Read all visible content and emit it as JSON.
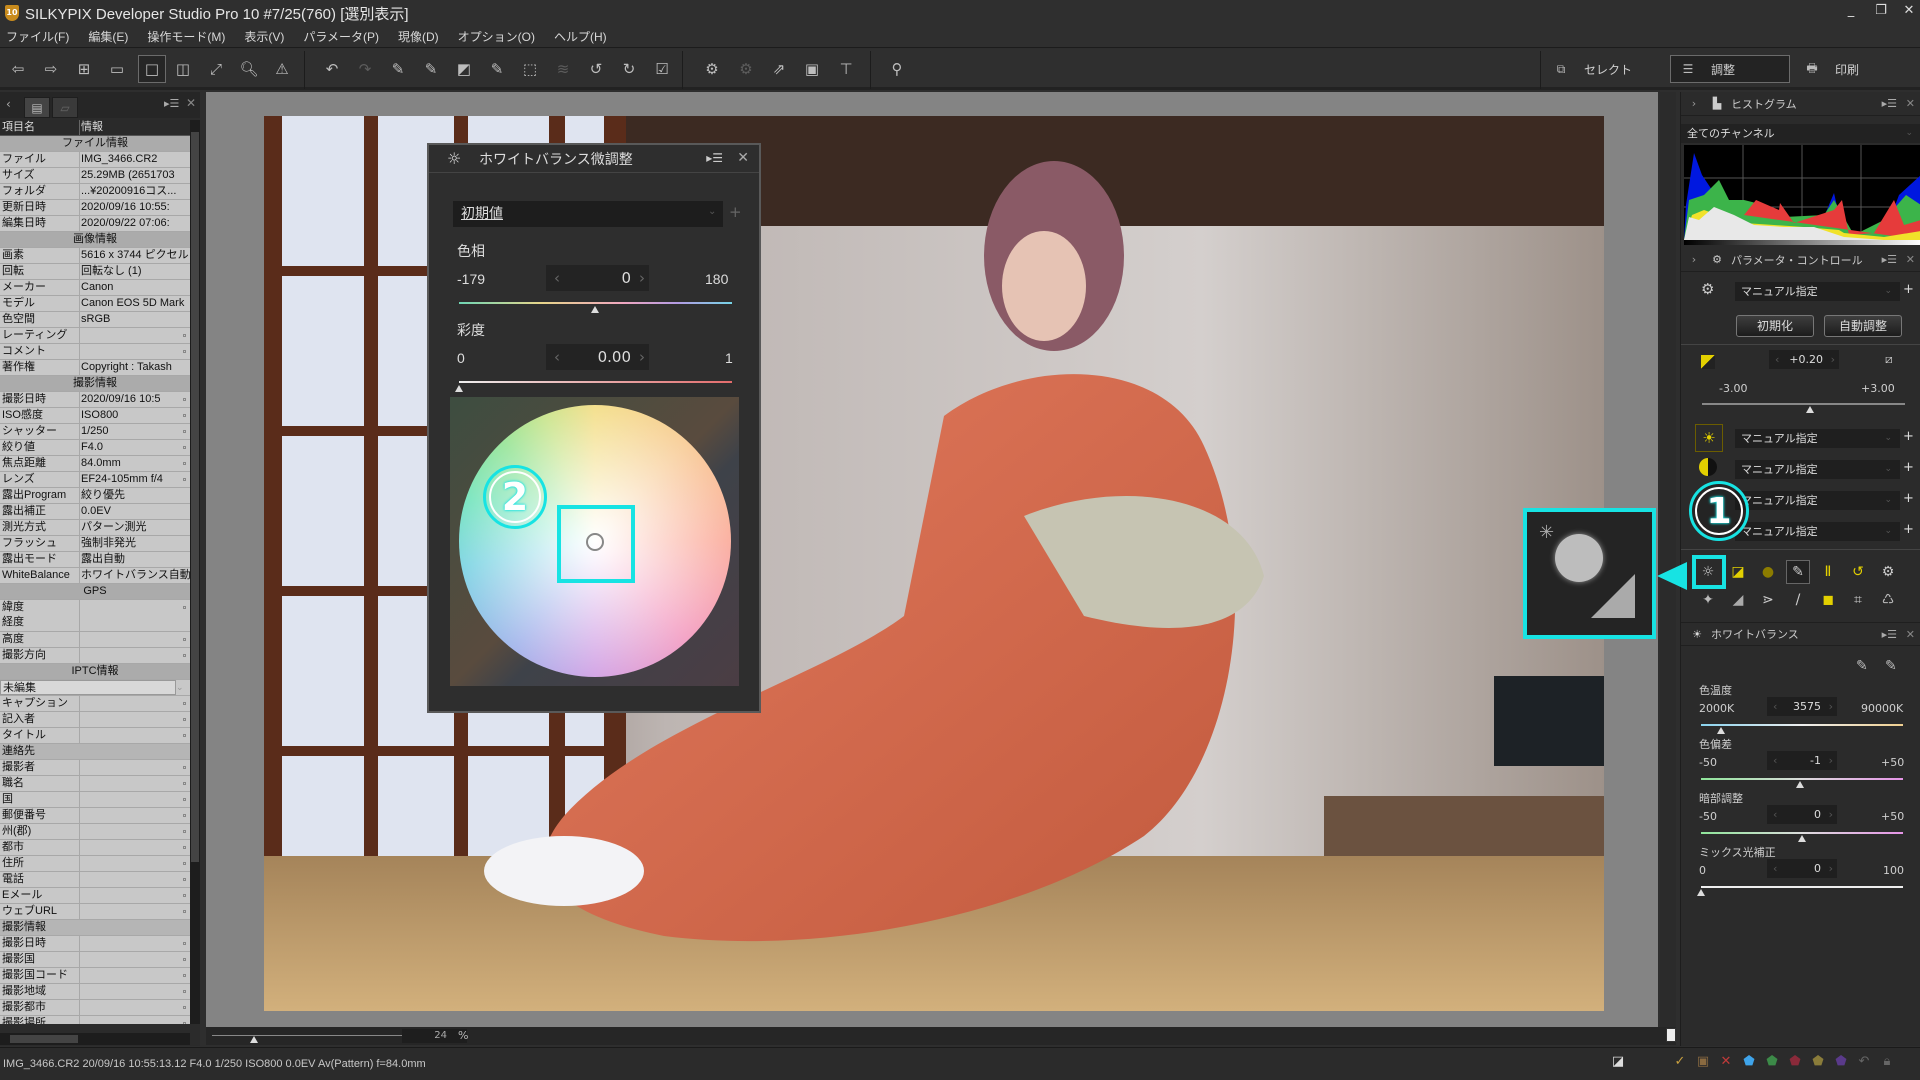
{
  "window": {
    "title": "SILKYPIX Developer Studio Pro 10   #7/25(760) [選別表示]",
    "app_icon_text": "10",
    "controls": {
      "minimize": "_",
      "restore": "❐",
      "close": "✕"
    }
  },
  "menu": [
    "ファイル(F)",
    "編集(E)",
    "操作モード(M)",
    "表示(V)",
    "パラメータ(P)",
    "現像(D)",
    "オプション(O)",
    "ヘルプ(H)"
  ],
  "toolbar": {
    "icons": [
      "prev-photo-icon",
      "next-photo-icon",
      "thumbnail-view-icon",
      "preview-thumbnail-view-icon",
      "single-view-icon",
      "compare-view-icon",
      "fullscreen-icon",
      "loupe-icon",
      "warning-icon",
      "undo-icon",
      "redo-icon",
      "exposure-tool-icon",
      "gray-tool-icon",
      "contrast-tool-icon",
      "film-tool-icon",
      "transform-icon",
      "layers-icon",
      "rotate-left-icon",
      "rotate-right-icon",
      "check-icon",
      "save-params-icon",
      "apply-params-icon",
      "export-icon",
      "display-icon",
      "hammer-icon",
      "search-zoom-icon"
    ],
    "modes": [
      {
        "label": "セレクト",
        "icon": "select-mode-icon",
        "active": false
      },
      {
        "label": "調整",
        "icon": "adjust-mode-icon",
        "active": true
      },
      {
        "label": "印刷",
        "icon": "printer-icon",
        "active": false
      }
    ]
  },
  "left_panel": {
    "header": {
      "key": "項目名",
      "value": "情報"
    },
    "rows": [
      {
        "type": "section",
        "label": "ファイル情報"
      },
      {
        "k": "ファイル",
        "v": "IMG_3466.CR2"
      },
      {
        "k": "サイズ",
        "v": "25.29MB (2651703"
      },
      {
        "k": "フォルダ",
        "v": "...¥20200916コス..."
      },
      {
        "k": "更新日時",
        "v": "2020/09/16 10:55:"
      },
      {
        "k": "編集日時",
        "v": "2020/09/22 07:06:"
      },
      {
        "type": "section",
        "label": "画像情報"
      },
      {
        "k": "画素",
        "v": "5616 x 3744 ピクセル"
      },
      {
        "k": "回転",
        "v": "回転なし (1)"
      },
      {
        "k": "メーカー",
        "v": "Canon"
      },
      {
        "k": "モデル",
        "v": "Canon EOS 5D Mark"
      },
      {
        "k": "色空間",
        "v": "sRGB"
      },
      {
        "k": "レーティング",
        "v": "",
        "dot": true
      },
      {
        "k": "コメント",
        "v": "",
        "dot": true
      },
      {
        "k": "著作権",
        "v": "Copyright : Takash"
      },
      {
        "type": "section",
        "label": "撮影情報"
      },
      {
        "k": "撮影日時",
        "v": "2020/09/16 10:5",
        "dot": true
      },
      {
        "k": "ISO感度",
        "v": "ISO800",
        "dot": true
      },
      {
        "k": "シャッター",
        "v": "1/250",
        "dot": true
      },
      {
        "k": "絞り値",
        "v": "F4.0",
        "dot": true
      },
      {
        "k": "焦点距離",
        "v": "84.0mm",
        "dot": true
      },
      {
        "k": "レンズ",
        "v": "EF24-105mm f/4",
        "dot": true
      },
      {
        "k": "露出Program",
        "v": "絞り優先"
      },
      {
        "k": "露出補正",
        "v": "0.0EV"
      },
      {
        "k": "測光方式",
        "v": "パターン測光"
      },
      {
        "k": "フラッシュ",
        "v": "強制非発光"
      },
      {
        "k": "露出モード",
        "v": "露出自動"
      },
      {
        "k": "WhiteBalance",
        "v": "ホワイトバランス自動"
      },
      {
        "type": "section",
        "label": "GPS"
      },
      {
        "k": "緯度\n経度",
        "v": "",
        "dot": true,
        "tall": true
      },
      {
        "k": "高度",
        "v": "",
        "dot": true
      },
      {
        "k": "撮影方向",
        "v": "",
        "dot": true
      },
      {
        "type": "section",
        "label": "IPTC情報"
      },
      {
        "type": "select",
        "label": "未編集"
      },
      {
        "k": "キャプション",
        "v": "",
        "dot": true
      },
      {
        "k": "記入者",
        "v": "",
        "dot": true
      },
      {
        "k": "タイトル",
        "v": "",
        "dot": true
      },
      {
        "type": "subsection",
        "label": "連絡先"
      },
      {
        "k": "撮影者",
        "v": "",
        "dot": true
      },
      {
        "k": "職名",
        "v": "",
        "dot": true
      },
      {
        "k": "国",
        "v": "",
        "dot": true
      },
      {
        "k": "郵便番号",
        "v": "",
        "dot": true
      },
      {
        "k": "州(郡)",
        "v": "",
        "dot": true
      },
      {
        "k": "都市",
        "v": "",
        "dot": true
      },
      {
        "k": "住所",
        "v": "",
        "dot": true
      },
      {
        "k": "電話",
        "v": "",
        "dot": true
      },
      {
        "k": "Eメール",
        "v": "",
        "dot": true
      },
      {
        "k": "ウェブURL",
        "v": "",
        "dot": true
      },
      {
        "type": "subsection",
        "label": "撮影情報"
      },
      {
        "k": "撮影日時",
        "v": "",
        "dot": true
      },
      {
        "k": "撮影国",
        "v": "",
        "dot": true
      },
      {
        "k": "撮影国コード",
        "v": "",
        "dot": true
      },
      {
        "k": "撮影地域",
        "v": "",
        "dot": true
      },
      {
        "k": "撮影都市",
        "v": "",
        "dot": true
      },
      {
        "k": "撮影場所",
        "v": "",
        "dot": true
      }
    ]
  },
  "viewer": {
    "zoom_percent": "24",
    "zoom_unit": "%"
  },
  "wb_dialog": {
    "title": "ホワイトバランス微調整",
    "preset": "初期値",
    "hue": {
      "label": "色相",
      "min": "-179",
      "max": "180",
      "value": "0",
      "fraction": 0.497
    },
    "saturation": {
      "label": "彩度",
      "min": "0",
      "max": "1",
      "value": "0.00",
      "fraction": 0.0
    },
    "badge": "2"
  },
  "right_panel": {
    "histogram": {
      "title": "ヒストグラム",
      "channel": "全てのチャンネル"
    },
    "param_control": {
      "title": "パラメータ・コントロール",
      "taste": "マニュアル指定",
      "reset_label": "初期化",
      "auto_label": "自動調整",
      "exposure": {
        "value": "+0.20",
        "min": "-3.00",
        "max": "+3.00",
        "fraction": 0.533
      },
      "presets": [
        "マニュアル指定",
        "マニュアル指定",
        "マニュアル指定",
        "マニュアル指定"
      ]
    },
    "badge": "1",
    "white_balance": {
      "title": "ホワイトバランス",
      "color_temp": {
        "label": "色温度",
        "min": "2000K",
        "max": "90000K",
        "value": "3575",
        "fraction": 0.1
      },
      "tint": {
        "label": "色偏差",
        "min": "-50",
        "max": "+50",
        "value": "-1",
        "fraction": 0.49
      },
      "shadow": {
        "label": "暗部調整",
        "min": "-50",
        "max": "+50",
        "value": "0",
        "fraction": 0.5
      },
      "mixed_light": {
        "label": "ミックス光補正",
        "min": "0",
        "max": "100",
        "value": "0",
        "fraction": 0.0
      }
    }
  },
  "status": {
    "text": "IMG_3466.CR2 20/09/16 10:55:13.12 F4.0 1/250 ISO800  0.0EV Av(Pattern) f=84.0mm"
  },
  "colors": {
    "highlight": "#17e3e3",
    "accent_yellow": "#c9b300"
  }
}
